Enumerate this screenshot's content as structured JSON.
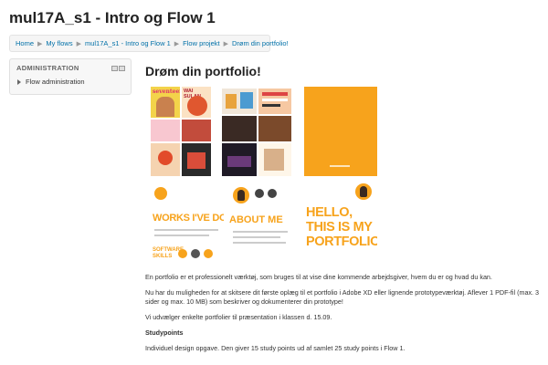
{
  "page": {
    "title": "mul17A_s1 - Intro og Flow 1"
  },
  "breadcrumb": {
    "items": [
      "Home",
      "My flows",
      "mul17A_s1 - Intro og Flow 1",
      "Flow projekt",
      "Drøm din portfolio!"
    ],
    "separator": "▶"
  },
  "sidebar": {
    "block_title": "ADMINISTRATION",
    "items": [
      {
        "label": "Flow administration",
        "icon": "triangle-right-icon"
      }
    ]
  },
  "main": {
    "title": "Drøm din portfolio!",
    "image": {
      "works_text": "WORKS I'VE DONE",
      "about_text": "ABOUT ME",
      "hello_text": "HELLO, THIS IS MY PORTFOLIO",
      "skills_text": "SOFTWARE SKILLS",
      "tile_brands": [
        "seventeen",
        "WAI SULAN"
      ],
      "accent": "#f7a31c"
    },
    "paragraphs": [
      "En portfolio er et professionelt værktøj, som bruges til at vise dine kommende arbejdsgiver, hvem du er og hvad du kan.",
      "Nu har du muligheden for at skitsere dit første oplæg til et portfolio i Adobe XD eller lignende prototypeværktøj. Aflever 1 PDF-fil (max. 3 sider og max. 10 MB) som beskriver og dokumenterer din prototype!",
      "Vi udvælger enkelte portfolier til præsentation i klassen d. 15.09."
    ],
    "studypoints_heading": "Studypoints",
    "studypoints_text": "Individuel design opgave. Den giver 15 study points ud af samlet 25 study points i Flow 1."
  }
}
